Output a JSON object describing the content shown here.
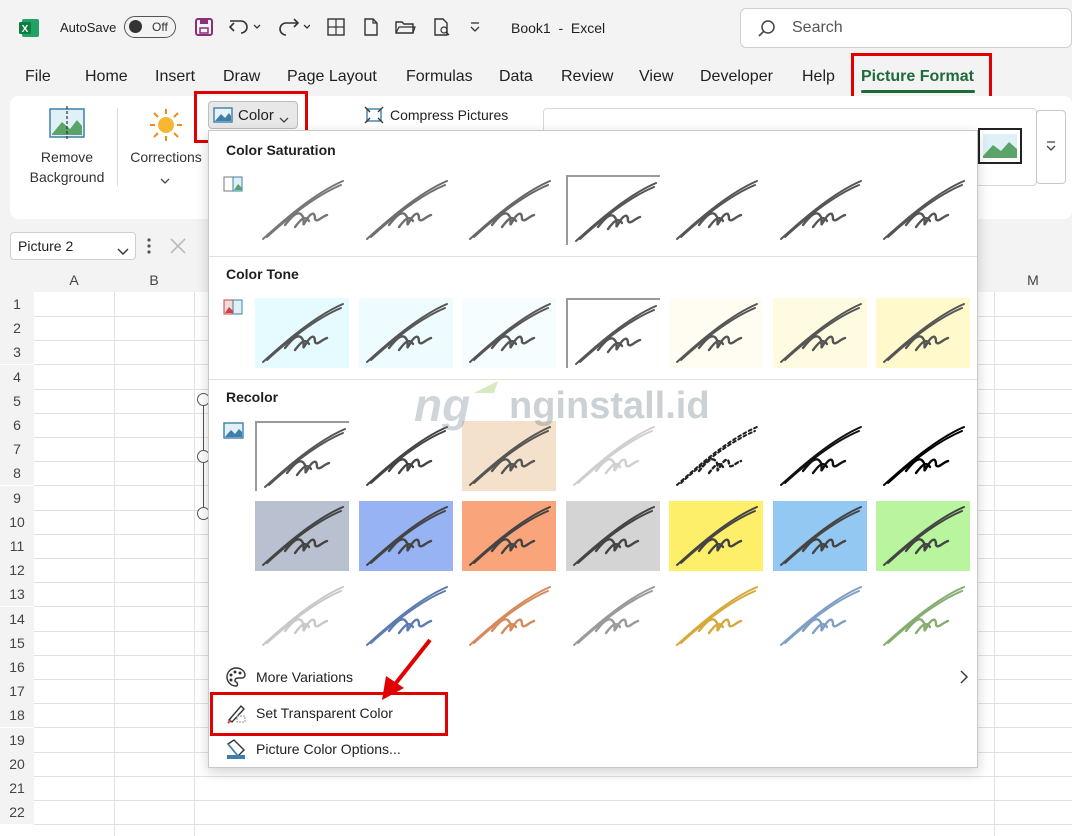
{
  "titlebar": {
    "autosave_label": "AutoSave",
    "autosave_state": "Off",
    "doc_title": "Book1  -  Excel",
    "search_placeholder": "Search"
  },
  "tabs": [
    "File",
    "Home",
    "Insert",
    "Draw",
    "Page Layout",
    "Formulas",
    "Data",
    "Review",
    "View",
    "Developer",
    "Help",
    "Picture Format"
  ],
  "active_tab": "Picture Format",
  "ribbon": {
    "remove_background": [
      "Remove",
      "Background"
    ],
    "corrections": "Corrections",
    "color_button": "Color",
    "compress_pictures": "Compress Pictures"
  },
  "formula_bar": {
    "name_box": "Picture 2"
  },
  "columns": [
    "A",
    "B",
    "M"
  ],
  "rows": [
    "1",
    "2",
    "3",
    "4",
    "5",
    "6",
    "7",
    "8",
    "9",
    "10",
    "11",
    "12",
    "13",
    "14",
    "15",
    "16",
    "17",
    "18",
    "19",
    "20",
    "21",
    "22"
  ],
  "dropdown": {
    "color_saturation": "Color Saturation",
    "color_tone": "Color Tone",
    "recolor": "Recolor",
    "more_variations": "More Variations",
    "set_transparent_color": "Set Transparent Color",
    "picture_color_options": "Picture Color Options...",
    "saturation_swatches": [
      {
        "bg": "#ffffff",
        "stroke": "#777777"
      },
      {
        "bg": "#ffffff",
        "stroke": "#6e6e6e"
      },
      {
        "bg": "#ffffff",
        "stroke": "#666666"
      },
      {
        "bg": "#ffffff",
        "stroke": "#555555",
        "selected": true
      },
      {
        "bg": "#ffffff",
        "stroke": "#555555"
      },
      {
        "bg": "#ffffff",
        "stroke": "#555555"
      },
      {
        "bg": "#ffffff",
        "stroke": "#555555"
      }
    ],
    "tone_swatches": [
      {
        "bg": "#e6fbff",
        "stroke": "#555555"
      },
      {
        "bg": "#effcff",
        "stroke": "#555555"
      },
      {
        "bg": "#f6fdff",
        "stroke": "#555555"
      },
      {
        "bg": "#ffffff",
        "stroke": "#555555",
        "selected": true
      },
      {
        "bg": "#fffdf2",
        "stroke": "#555555"
      },
      {
        "bg": "#fffbe0",
        "stroke": "#555555"
      },
      {
        "bg": "#fff9cc",
        "stroke": "#555555"
      }
    ],
    "recolor_swatches": [
      {
        "bg": "#ffffff",
        "stroke": "#555555",
        "selected": true
      },
      {
        "bg": "#ffffff",
        "stroke": "#444444"
      },
      {
        "bg": "#f3e1cb",
        "stroke": "#555555"
      },
      {
        "bg": "#ffffff",
        "stroke": "#cfcfcf"
      },
      {
        "bg": "#ffffff",
        "stroke": "#222222",
        "dashed": true
      },
      {
        "bg": "#ffffff",
        "stroke": "#111111"
      },
      {
        "bg": "#ffffff",
        "stroke": "#000000"
      },
      {
        "bg": "#b9c1d0",
        "stroke": "#444444"
      },
      {
        "bg": "#97b3f4",
        "stroke": "#444444"
      },
      {
        "bg": "#f9a47a",
        "stroke": "#444444"
      },
      {
        "bg": "#d4d4d4",
        "stroke": "#444444"
      },
      {
        "bg": "#fdef6a",
        "stroke": "#444444"
      },
      {
        "bg": "#93c8f3",
        "stroke": "#444444"
      },
      {
        "bg": "#b8f59e",
        "stroke": "#444444"
      },
      {
        "bg": "#ffffff",
        "stroke": "#c8c8c8"
      },
      {
        "bg": "#ffffff",
        "stroke": "#5d7bb0"
      },
      {
        "bg": "#ffffff",
        "stroke": "#d68a5c"
      },
      {
        "bg": "#ffffff",
        "stroke": "#9a9a9a"
      },
      {
        "bg": "#ffffff",
        "stroke": "#d6a93a"
      },
      {
        "bg": "#ffffff",
        "stroke": "#7f9fc4"
      },
      {
        "bg": "#ffffff",
        "stroke": "#86ac6e"
      }
    ]
  },
  "watermark": "nginstall.id",
  "colors": {
    "accent_green": "#1e6b3a",
    "highlight_red": "#e00000"
  }
}
